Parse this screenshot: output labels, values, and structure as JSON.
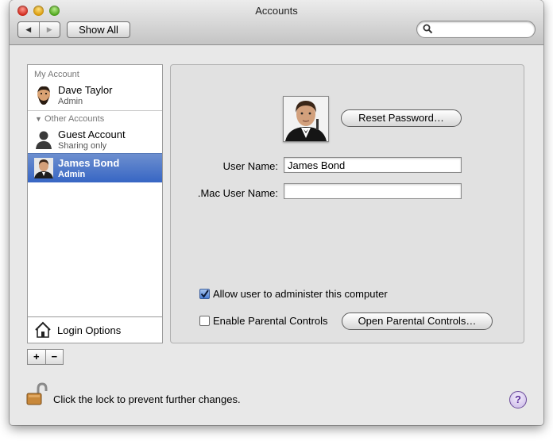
{
  "window": {
    "title": "Accounts"
  },
  "toolbar": {
    "back": "◀",
    "forward": "▶",
    "show_all": "Show All",
    "search_placeholder": ""
  },
  "sidebar": {
    "my_account_header": "My Account",
    "other_accounts_header": "Other Accounts",
    "accounts": [
      {
        "name": "Dave Taylor",
        "role": "Admin"
      },
      {
        "name": "Guest Account",
        "role": "Sharing only"
      },
      {
        "name": "James Bond",
        "role": "Admin"
      }
    ],
    "login_options": "Login Options",
    "add": "+",
    "remove": "−"
  },
  "detail": {
    "reset_password": "Reset Password…",
    "user_name_label": "User Name:",
    "user_name_value": "James Bond",
    "mac_user_name_label": ".Mac User Name:",
    "mac_user_name_value": "",
    "allow_admin_label": "Allow user to administer this computer",
    "allow_admin_checked": true,
    "parental_label": "Enable Parental Controls",
    "parental_checked": false,
    "open_parental": "Open Parental Controls…"
  },
  "footer": {
    "lock_text": "Click the lock to prevent further changes.",
    "help": "?"
  },
  "colors": {
    "selection": "#3766c4",
    "window_bg": "#e8e8e8"
  }
}
